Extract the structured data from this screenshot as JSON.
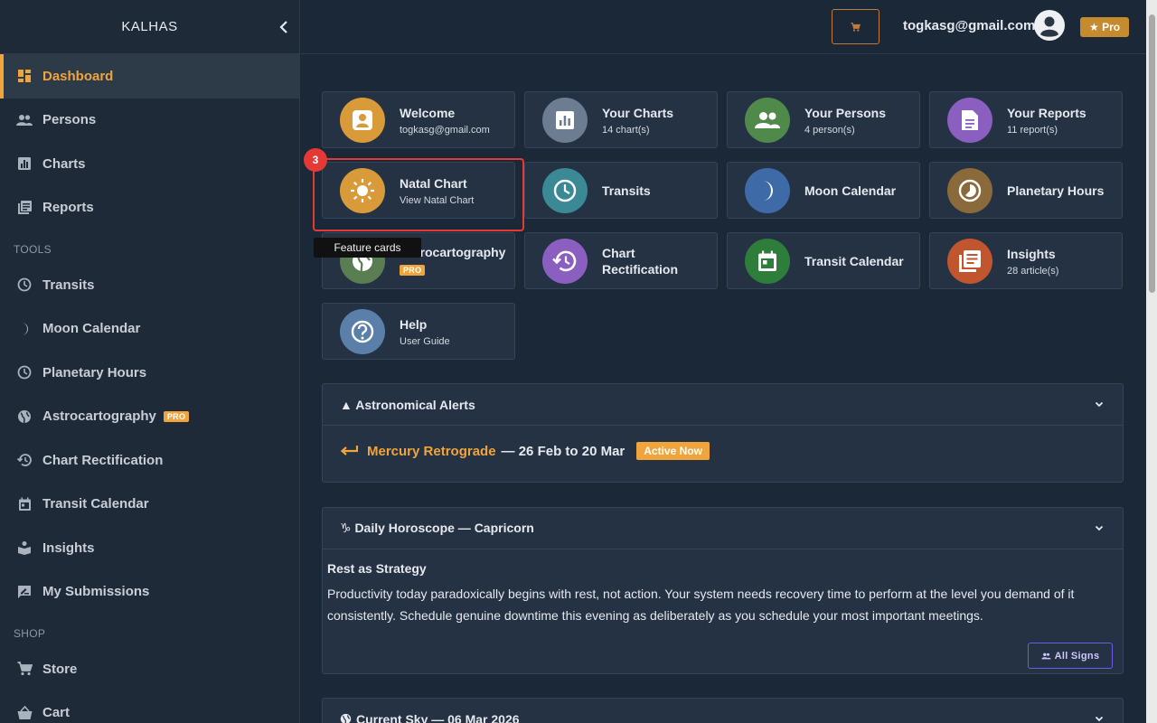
{
  "brand": "KALHAS",
  "sidebar": {
    "items": [
      {
        "label": "Dashboard"
      },
      {
        "label": "Persons"
      },
      {
        "label": "Charts"
      },
      {
        "label": "Reports"
      }
    ],
    "tools_label": "TOOLS",
    "tools": [
      {
        "label": "Transits"
      },
      {
        "label": "Moon Calendar"
      },
      {
        "label": "Planetary Hours"
      },
      {
        "label": "Astrocartography",
        "badge": "PRO"
      },
      {
        "label": "Chart Rectification"
      },
      {
        "label": "Transit Calendar"
      },
      {
        "label": "Insights"
      },
      {
        "label": "My Submissions"
      }
    ],
    "shop_label": "SHOP",
    "shop": [
      {
        "label": "Store"
      },
      {
        "label": "Cart"
      }
    ]
  },
  "header": {
    "email": "togkasg@gmail.com",
    "pro_label": "★ Pro"
  },
  "cards": [
    {
      "title": "Welcome",
      "subtitle": "togkasg@gmail.com"
    },
    {
      "title": "Your Charts",
      "subtitle": "14 chart(s)"
    },
    {
      "title": "Your Persons",
      "subtitle": "4 person(s)"
    },
    {
      "title": "Your Reports",
      "subtitle": "11 report(s)"
    },
    {
      "title": "Natal Chart",
      "subtitle": "View Natal Chart"
    },
    {
      "title": "Transits"
    },
    {
      "title": "Moon Calendar"
    },
    {
      "title": "Planetary Hours"
    },
    {
      "title": "Astrocartography",
      "badge": "PRO"
    },
    {
      "title": "Chart Rectification"
    },
    {
      "title": "Transit Calendar"
    },
    {
      "title": "Insights",
      "subtitle": "28 article(s)"
    },
    {
      "title": "Help",
      "subtitle": "User Guide"
    }
  ],
  "highlight": {
    "number": "3",
    "tooltip": "Feature cards"
  },
  "alerts": {
    "title": "▲ Astronomical Alerts",
    "item_name": "Mercury Retrograde",
    "item_dates": "— 26 Feb to 20 Mar",
    "item_status": "Active Now"
  },
  "horoscope": {
    "title": "♑ Daily Horoscope — Capricorn",
    "heading": "Rest as Strategy",
    "body": "Productivity today paradoxically begins with rest, not action. Your system needs recovery time to perform at the level you demand of it consistently. Schedule genuine downtime this evening as deliberately as you schedule your most important meetings.",
    "button": "All Signs"
  },
  "sky": {
    "title": "Current Sky — 06 Mar 2026"
  },
  "colors": {
    "accent": "#f0a53c",
    "background": "#1b2838",
    "sidebar": "#1e2a38",
    "highlight": "#e53935"
  }
}
